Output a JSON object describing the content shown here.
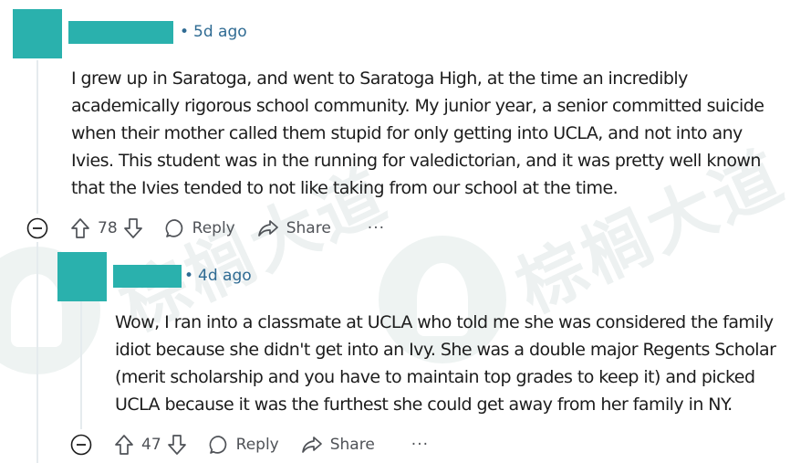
{
  "comments": [
    {
      "time": "5d ago",
      "body": "I grew up in Saratoga, and went to Saratoga High, at the time an incredibly\nacademically rigorous school community. My junior year, a senior committed suicide\nwhen their mother called them stupid for only getting into UCLA, and not into any\nIvies. This student was in the running for valedictorian, and it was pretty well known\nthat the Ivies tended to not like taking from our school at the time.",
      "votes": "78",
      "reply_label": "Reply",
      "share_label": "Share",
      "more_label": "···"
    },
    {
      "time": "4d ago",
      "body": "Wow, I ran into a classmate at UCLA who told me she was considered the family\nidiot because she didn't get into an Ivy. She was a double major Regents Scholar\n(merit scholarship and you have to maintain top grades to keep it) and picked\nUCLA because it was the furthest she could get away from her family in NY.",
      "votes": "47",
      "reply_label": "Reply",
      "share_label": "Share",
      "more_label": "···"
    }
  ],
  "meta_separator": "•",
  "watermark_text": "棕榈大道",
  "colors": {
    "avatar": "#2ab1ad",
    "meta": "#2f6b93",
    "text": "#1c1c1c",
    "action": "#4f5257"
  }
}
